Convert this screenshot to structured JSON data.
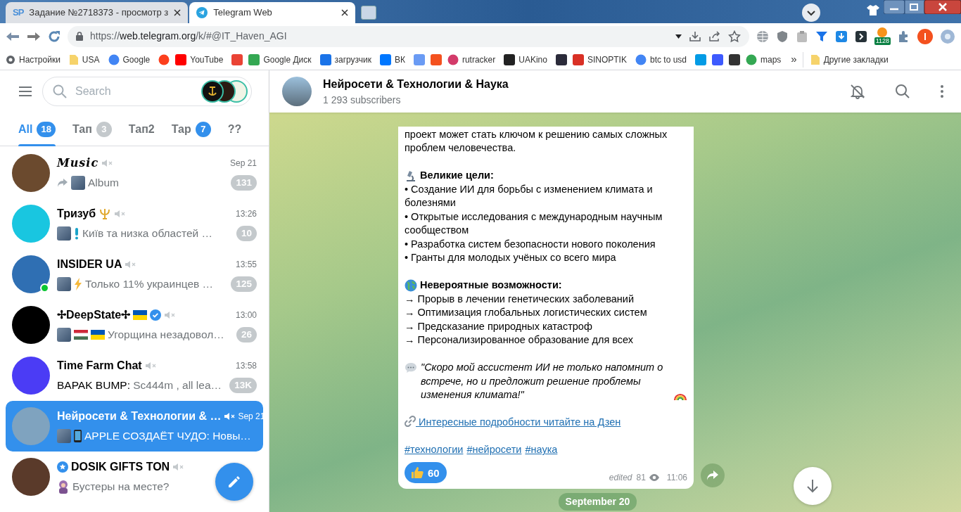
{
  "browser": {
    "tabs": [
      {
        "favicon_text": "SP",
        "title": "Задание №2718373 - просмотр з",
        "selected": false
      },
      {
        "title": "Telegram Web",
        "selected": true
      }
    ],
    "address": {
      "scheme": "https://",
      "host": "web.telegram.org",
      "path": "/k/#@IT_Haven_AGI"
    },
    "extension_badge": "1128",
    "bookmarks": [
      {
        "label": "Настройки",
        "kind": "gear",
        "color": "#5f6368"
      },
      {
        "label": "USA",
        "kind": "folder",
        "color": "#f6d36b"
      },
      {
        "label": "Google",
        "kind": "circle",
        "color": "#4285f4"
      },
      {
        "kind": "circle",
        "color": "#fc3f1d"
      },
      {
        "label": "YouTube",
        "kind": "square",
        "color": "#ff0000"
      },
      {
        "kind": "square",
        "color": "#ea4335"
      },
      {
        "label": "Google Диск",
        "kind": "square",
        "color": "#34a853"
      },
      {
        "label": "загрузчик",
        "kind": "square",
        "color": "#1a73e8"
      },
      {
        "label": "ВК",
        "kind": "square",
        "color": "#0077ff"
      },
      {
        "kind": "square",
        "color": "#6a9bf4"
      },
      {
        "kind": "square",
        "color": "#f4511e"
      },
      {
        "label": "rutracker",
        "kind": "circle",
        "color": "#d33b6a"
      },
      {
        "label": "UAKino",
        "kind": "square",
        "color": "#222222"
      },
      {
        "kind": "square",
        "color": "#2b2b3a"
      },
      {
        "label": "SINOPTIK",
        "kind": "square",
        "color": "#d93025"
      },
      {
        "label": "btc to usd",
        "kind": "circle",
        "color": "#4285f4"
      },
      {
        "kind": "square",
        "color": "#039be5"
      },
      {
        "kind": "square",
        "color": "#3d5afe"
      },
      {
        "kind": "square",
        "color": "#333333"
      },
      {
        "label": "maps",
        "kind": "circle",
        "color": "#34a853"
      }
    ],
    "overflow": "»",
    "other_bookmarks": "Другие закладки"
  },
  "sidebar": {
    "search": {
      "placeholder": "Search"
    },
    "folders": [
      {
        "label": "All",
        "count": "18",
        "count_muted": false,
        "selected": true
      },
      {
        "label": "Тап",
        "count": "3",
        "count_muted": true,
        "selected": false
      },
      {
        "label": "Тап2",
        "selected": false
      },
      {
        "label": "Тар",
        "count": "7",
        "count_muted": false,
        "selected": false
      },
      {
        "label": "??",
        "selected": false
      }
    ],
    "chats": [
      {
        "name": "Music",
        "script_font": true,
        "time": "Sep 21",
        "attachments": [
          {
            "kind": "forward"
          },
          {
            "kind": "photo"
          }
        ],
        "preview": "Album",
        "unread": "131",
        "muted": true,
        "verified": false,
        "online": false,
        "selected": false,
        "color": "#6b4a2e"
      },
      {
        "name": "Тризуб",
        "script_font": false,
        "icon_after": {
          "kind": "trident"
        },
        "time": "13:26",
        "attachments": [
          {
            "kind": "photo"
          },
          {
            "kind": "exclamation"
          }
        ],
        "preview": "Київ та низка областей …",
        "unread": "10",
        "muted": true,
        "verified": false,
        "online": false,
        "selected": false,
        "color": "#19c6e0"
      },
      {
        "name": "INSIDER UA",
        "script_font": false,
        "time": "13:55",
        "attachments": [
          {
            "kind": "photo"
          },
          {
            "kind": "lightning"
          }
        ],
        "preview": "Только 11% украинцев …",
        "unread": "125",
        "muted": true,
        "verified": false,
        "online": true,
        "selected": false,
        "color": "#2f6fb3"
      },
      {
        "name": "✢DeepState✢",
        "script_font": false,
        "icon_after": {
          "kind": "flag"
        },
        "time": "13:00",
        "attachments": [
          {
            "kind": "photo"
          },
          {
            "kind": "tricolor"
          },
          {
            "kind": "flag"
          }
        ],
        "preview": "Угорщина незадовол…",
        "unread": "26",
        "muted": true,
        "verified": true,
        "online": false,
        "selected": false,
        "color": "#000000"
      },
      {
        "name": "Time Farm Chat",
        "script_font": false,
        "time": "13:58",
        "sender": "BAPAK BUMP:",
        "preview": "Sc444m , all lea…",
        "unread": "13K",
        "muted": true,
        "verified": false,
        "online": false,
        "selected": false,
        "color": "#4b3cf5"
      },
      {
        "name": "Нейросети & Технологии & …",
        "script_font": false,
        "time": "Sep 21",
        "attachments": [
          {
            "kind": "photo"
          },
          {
            "kind": "phone"
          }
        ],
        "preview": "APPLE СОЗДАЁТ ЧУДО: Новы…",
        "muted": true,
        "verified": false,
        "online": false,
        "selected": true,
        "color": "#7fa3bf"
      },
      {
        "name": "DOSIK GIFTS TON",
        "script_font": false,
        "icon_before": {
          "kind": "badge"
        },
        "attachments": [
          {
            "kind": "sticker"
          }
        ],
        "preview": "Бустеры на месте?",
        "muted": true,
        "verified": false,
        "online": false,
        "selected": false,
        "color": "#5a3a2a"
      }
    ]
  },
  "chat": {
    "title": "Нейросети & Технологии & Наука",
    "subtitle": "1 293 subscribers",
    "message": {
      "blocks": [
        {
          "kind": "text",
          "text": "проект может стать ключом к решению самых сложных проблем человечества."
        },
        {
          "kind": "heading",
          "text": "Великие цели:"
        },
        {
          "kind": "line",
          "text": "• Создание ИИ для борьбы с изменением климата и болезнями"
        },
        {
          "kind": "line",
          "text": "• Открытые исследования с международным научным сообществом"
        },
        {
          "kind": "line",
          "text": "• Разработка систем безопасности нового поколения"
        },
        {
          "kind": "line",
          "text": "• Гранты для молодых учёных со всего мира"
        },
        {
          "kind": "heading",
          "text": "Невероятные возможности:"
        },
        {
          "kind": "line",
          "text": "→ Прорыв в лечении генетических заболеваний"
        },
        {
          "kind": "line",
          "text": "→ Оптимизация глобальных логистических систем"
        },
        {
          "kind": "line",
          "text": "→ Предсказание природных катастроф"
        },
        {
          "kind": "line",
          "text": "→ Персонализированное образование для всех"
        },
        {
          "kind": "quote",
          "text": "\"Скоро мой ассистент ИИ не только напомнит о встрече, но и предложит решение проблемы изменения климата!\""
        },
        {
          "kind": "link",
          "text": "Интересные подробности читайте на Дзен"
        },
        {
          "kind": "hashtags",
          "tags": [
            "#технологии",
            "#нейросети",
            "#наука"
          ]
        }
      ],
      "reaction": {
        "count": "60",
        "selected": true
      },
      "edited": "edited",
      "views": "81",
      "time": "11:06"
    },
    "date": "September 20"
  }
}
